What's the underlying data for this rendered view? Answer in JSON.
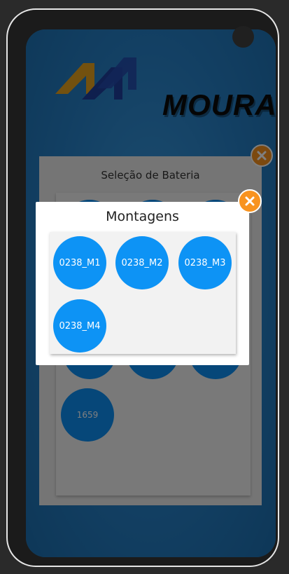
{
  "app": {
    "logo_text": "MOURA"
  },
  "background_panel": {
    "title": "Seleção de Bateria",
    "visible_item": "1659"
  },
  "modal": {
    "title": "Montagens",
    "items": [
      "0238_M1",
      "0238_M2",
      "0238_M3",
      "0238_M4"
    ]
  },
  "colors": {
    "accent_orange": "#f8931f",
    "item_blue": "#0d93f5",
    "screen_blue": "#2680c7"
  }
}
